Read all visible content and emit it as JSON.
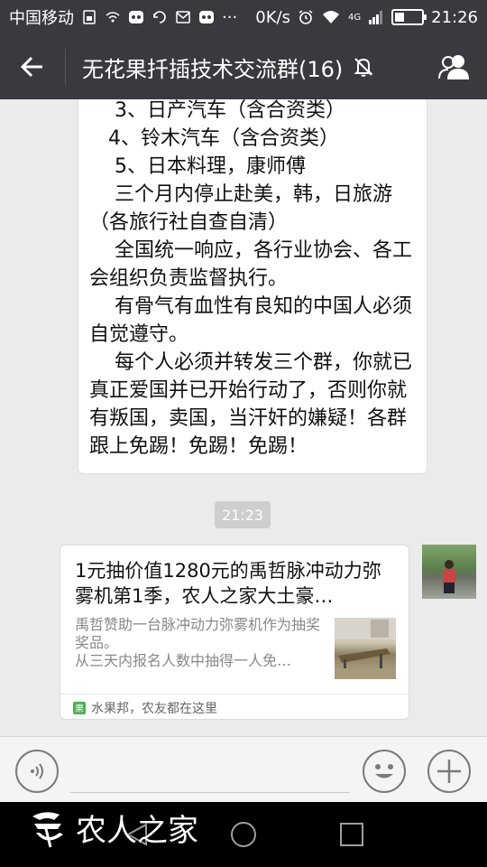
{
  "status_bar": {
    "carrier": "中国移动",
    "speed": "0K/s",
    "network": "4G",
    "time": "21:26",
    "battery_level": 0.35
  },
  "header": {
    "title": "无花果扦插技术交流群(16)"
  },
  "messages": {
    "text_message": {
      "text": "    3、日产汽车（含合资类）\n   4、铃木汽车（含合资类）\n    5、日本料理，康师傅\n    三个月内停止赴美，韩，日旅游（各旅行社自查自清）\n    全国统一响应，各行业协会、各工会组织负责监督执行。\n    有骨气有血性有良知的中国人必须自觉遵守。\n    每个人必须并转发三个群，你就已真正爱国并已开始行动了，否则你就有叛国，卖国，当汗奸的嫌疑！各群跟上免踢！免踢！免踢！"
    },
    "timestamp": "21:23",
    "link_card": {
      "title": "1元抽价值1280元的禹哲脉冲动力弥雾机第1季，农人之家大土豪…",
      "description": "禹哲赞助一台脉冲动力弥雾机作为抽奖奖品。\n从三天内报名人数中抽得一人免…",
      "source": "水果邦，农友都在这里"
    }
  },
  "input_bar": {
    "placeholder": ""
  },
  "watermark": {
    "text": "农人之家"
  }
}
